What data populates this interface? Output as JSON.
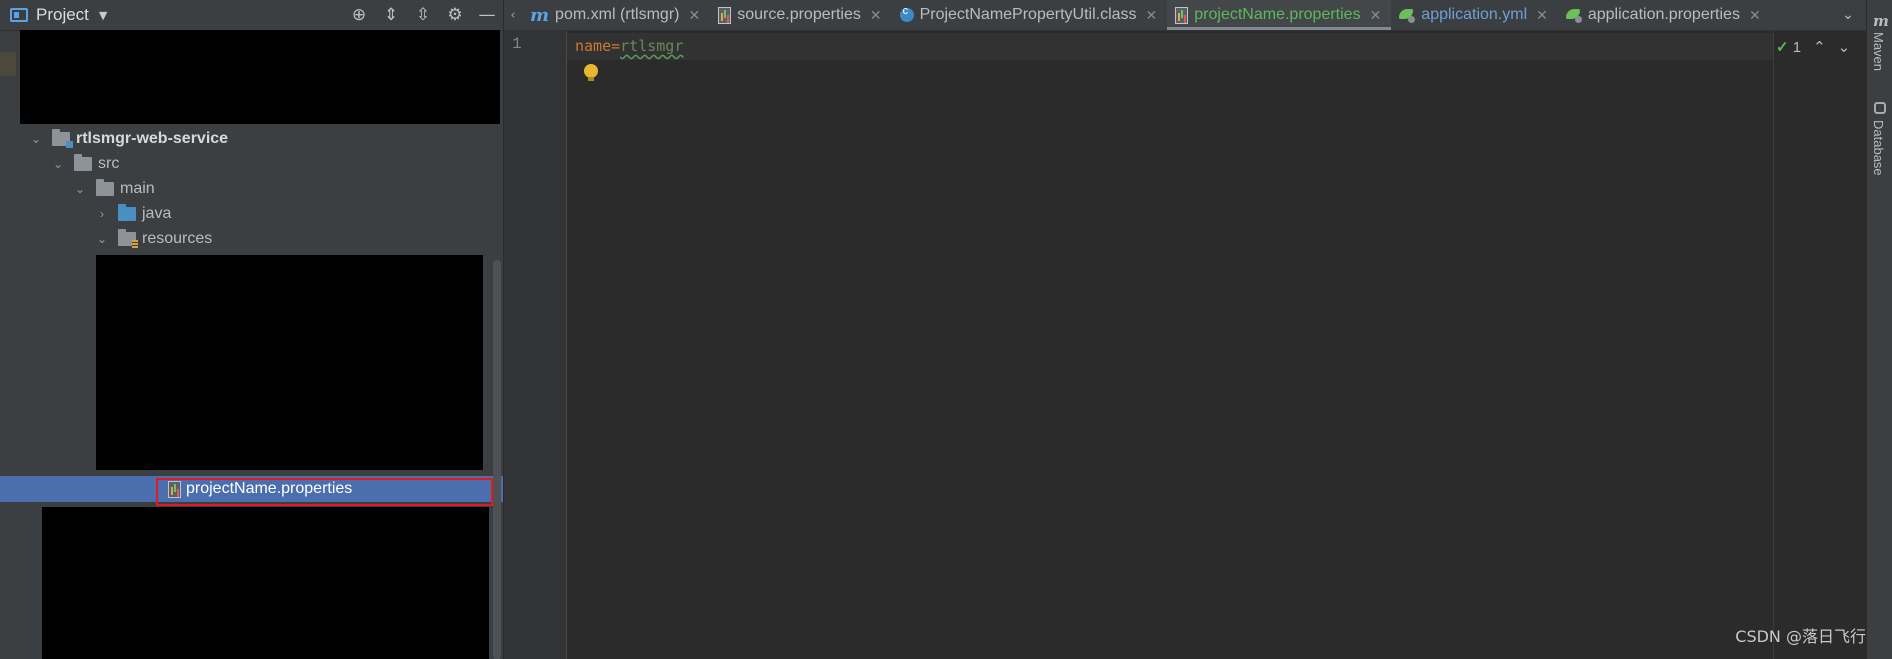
{
  "project_panel": {
    "title": "Project",
    "tools": [
      "locate-icon",
      "expand-all-icon",
      "collapse-all-icon",
      "gear-icon",
      "minimize-icon"
    ]
  },
  "tree": {
    "module": "rtlsmgr-web-service",
    "src": "src",
    "main": "main",
    "java": "java",
    "resources": "resources",
    "selected_file": "projectName.properties"
  },
  "tabs": [
    {
      "label": "pom.xml (rtlsmgr)",
      "icon": "maven-icon"
    },
    {
      "label": "source.properties",
      "icon": "properties-file-icon"
    },
    {
      "label": "ProjectNamePropertyUtil.class",
      "icon": "class-icon"
    },
    {
      "label": "projectName.properties",
      "icon": "properties-file-icon",
      "active": true
    },
    {
      "label": "application.yml",
      "icon": "spring-config-icon"
    },
    {
      "label": "application.properties",
      "icon": "spring-config-icon"
    }
  ],
  "editor": {
    "line_number": "1",
    "key": "name",
    "separator": "=",
    "value": "rtlsmgr",
    "inspection_count": "1"
  },
  "right_strip": {
    "maven_label": "Maven",
    "database_label": "Database"
  },
  "watermark": "CSDN @落日飞行",
  "colors": {
    "panel_bg": "#3c3f41",
    "editor_bg": "#2b2b2b",
    "selection": "#4b6eaf",
    "active_tab_text": "#5db85c",
    "outline_red": "#e01b24"
  }
}
